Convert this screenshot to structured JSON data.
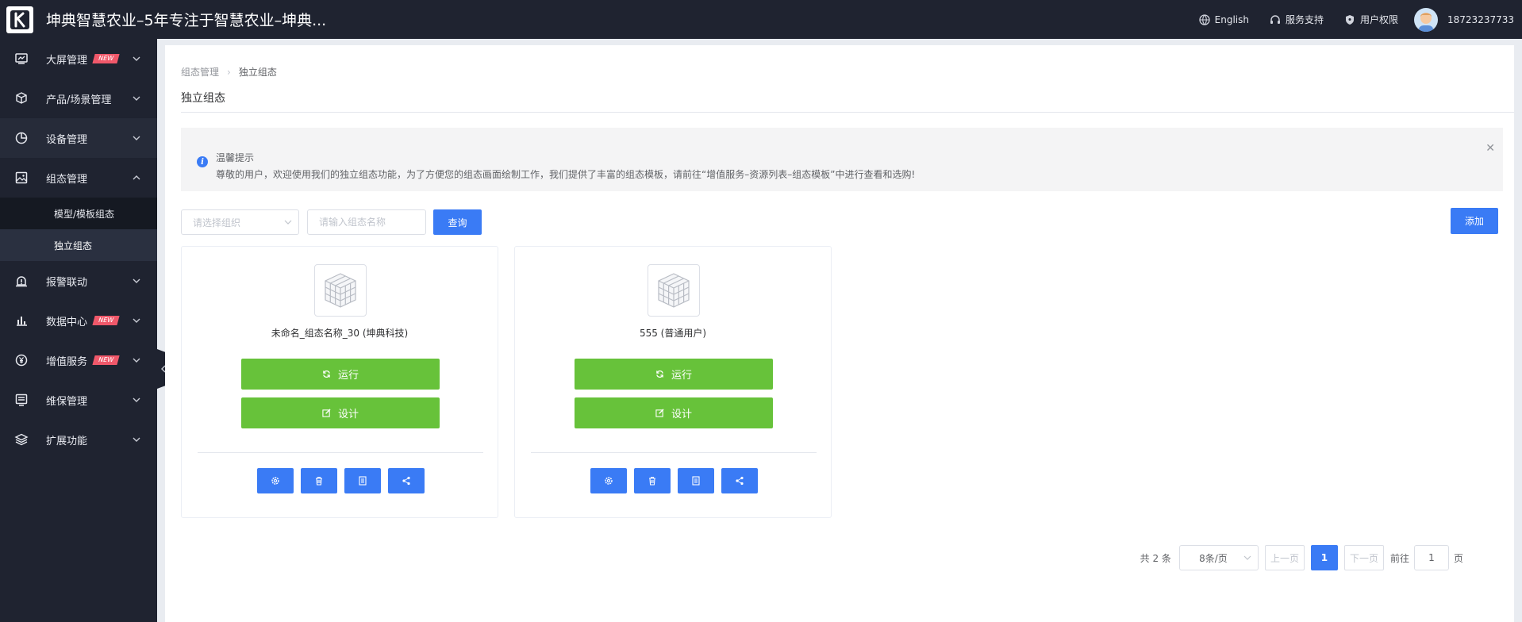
{
  "header": {
    "title": "坤典智慧农业–5年专注于智慧农业–坤典...",
    "language": "English",
    "support": "服务支持",
    "permission": "用户权限",
    "username": "18723237733"
  },
  "sidebar": {
    "items": [
      {
        "label": "大屏管理",
        "badge": "NEW"
      },
      {
        "label": "产品/场景管理"
      },
      {
        "label": "设备管理"
      },
      {
        "label": "组态管理"
      },
      {
        "label": "报警联动"
      },
      {
        "label": "数据中心",
        "badge": "NEW"
      },
      {
        "label": "增值服务",
        "badge": "NEW"
      },
      {
        "label": "维保管理"
      },
      {
        "label": "扩展功能"
      }
    ],
    "submenu": [
      {
        "label": "模型/模板组态"
      },
      {
        "label": "独立组态"
      }
    ]
  },
  "breadcrumb": {
    "parent": "组态管理",
    "current": "独立组态"
  },
  "page_title": "独立组态",
  "alert": {
    "title": "温馨提示",
    "desc": "尊敬的用户，欢迎使用我们的独立组态功能，为了方便您的组态画面绘制工作，我们提供了丰富的组态模板，请前往“增值服务–资源列表–组态模板”中进行查看和选购!"
  },
  "filters": {
    "org_placeholder": "请选择组织",
    "name_placeholder": "请输入组态名称",
    "query_label": "查询",
    "add_label": "添加"
  },
  "cards": [
    {
      "name": "未命名_组态名称_30 (坤典科技)",
      "run_label": "运行",
      "design_label": "设计"
    },
    {
      "name": "555 (普通用户)",
      "run_label": "运行",
      "design_label": "设计"
    }
  ],
  "pagination": {
    "total": "共 2 条",
    "page_size": "8条/页",
    "prev": "上一页",
    "current": "1",
    "next": "下一页",
    "goto_prefix": "前往",
    "goto_value": "1",
    "goto_suffix": "页"
  },
  "colors": {
    "primary": "#3a7bf5",
    "success": "#67c23a",
    "sidebar_bg": "#1f2330",
    "badge": "#f0586a"
  }
}
